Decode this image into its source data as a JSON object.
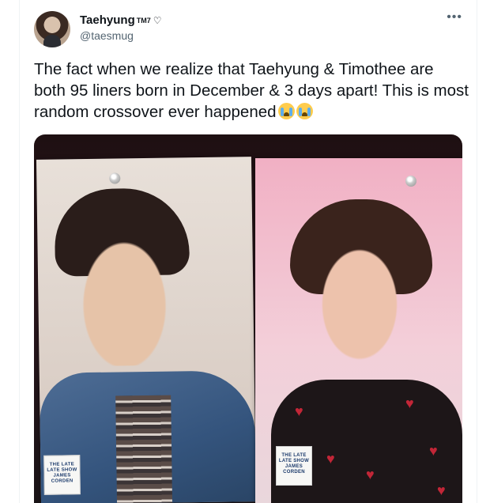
{
  "tweet": {
    "display_name": "Taehyung",
    "name_suffix": "TM7",
    "name_heart": "♡",
    "handle": "@taesmug",
    "more_icon": "more-horizontal-icon",
    "text": "The fact when we realize that Taehyung & Timothee are both 95 liners born in December & 3 days apart! This is most random crossover ever happened",
    "emoji_count_icon": "loudly-crying-face-emoji"
  },
  "media": {
    "stickers": [
      {
        "text": "THE LATE LATE SHOW JAMES CORDEN"
      },
      {
        "text": "THE LATE LATE SHOW JAMES CORDEN"
      }
    ]
  },
  "colors": {
    "text_primary": "#0f1419",
    "text_secondary": "#536471",
    "border": "#eff3f4"
  }
}
